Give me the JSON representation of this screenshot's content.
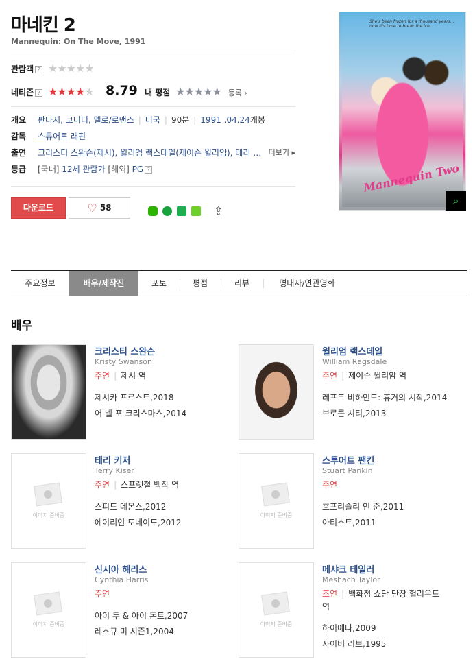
{
  "movie": {
    "title": "마네킨 2",
    "subtitle": "Mannequin: On The Move, 1991"
  },
  "ratings": {
    "audience_label": "관람객",
    "audience_stars": "★★★★★",
    "netizen_label": "네티즌",
    "netizen_stars_on": "★★★★",
    "netizen_stars_off": "★",
    "netizen_score": "8.79",
    "my_label": "내 평점",
    "my_stars": "★★★★★",
    "register": "등록"
  },
  "info": {
    "genre_label": "개요",
    "genres": "판타지, 코미디, 멜로/로맨스",
    "country": "미국",
    "runtime": "90분",
    "release_date": "1991 .04.24",
    "release_suffix": "개봉",
    "director_label": "감독",
    "director": "스튜어트 래핀",
    "cast_label": "출연",
    "cast": "크리스티 스완슨(제시), 윌리엄 랙스데일(제이슨 윌리암), 테리 …",
    "more": "더보기",
    "grade_label": "등급",
    "grade_kr_bracket": "[국내]",
    "grade_kr": "12세 관람가",
    "grade_intl_bracket": "[해외]",
    "grade_intl": "PG"
  },
  "actions": {
    "download": "다운로드",
    "likes": "58",
    "heart": "♡",
    "share": "⇪"
  },
  "poster": {
    "tagline": "She's been frozen for a thousand years... now it's time to break the ice.",
    "title_art": "Mannequin Two",
    "zoom_icon": "⌕"
  },
  "tabs": [
    {
      "label": "주요정보"
    },
    {
      "label": "배우/제작진"
    },
    {
      "label": "포토"
    },
    {
      "label": "평점"
    },
    {
      "label": "리뷰"
    },
    {
      "label": "명대사/연관영화"
    }
  ],
  "section": {
    "title": "배우",
    "noimg": "이미지 준비중"
  },
  "actors": [
    {
      "name": "크리스티 스완슨",
      "en": "Kristy Swanson",
      "role": "주연",
      "char": "제시 역",
      "works": [
        "제시카 프르스트,2018",
        "어 벨 포 크리스마스,2014"
      ]
    },
    {
      "name": "윌리엄 랙스데일",
      "en": "William Ragsdale",
      "role": "주연",
      "char": "제이슨 윌리암 역",
      "works": [
        "레프트 비하인드: 휴거의 시작,2014",
        "브로큰 시티,2013"
      ]
    },
    {
      "name": "테리 키저",
      "en": "Terry Kiser",
      "role": "주연",
      "char": "스프렛쳘 백작 역",
      "works": [
        "스피드 데몬스,2012",
        "에이리언 토네이도,2012"
      ]
    },
    {
      "name": "스투어트 팬킨",
      "en": "Stuart Pankin",
      "role": "주연",
      "char": "",
      "works": [
        "호프리슬리 인 준,2011",
        "아티스트,2011"
      ]
    },
    {
      "name": "신시아 해리스",
      "en": "Cynthia Harris",
      "role": "주연",
      "char": "",
      "works": [
        "아이 두 & 아이 돈트,2007",
        "레스큐 미 시즌1,2004"
      ]
    },
    {
      "name": "메샤크 테일러",
      "en": "Meshach Taylor",
      "role": "조연",
      "char": "백화점 쇼단 단장 헐리우드 역",
      "works": [
        "하이에나,2009",
        "사이버 러브,1995"
      ]
    }
  ],
  "colors": {
    "accent": "#e24b4b",
    "link": "#2d4f8c",
    "tab_active": "#8a8a8a"
  }
}
